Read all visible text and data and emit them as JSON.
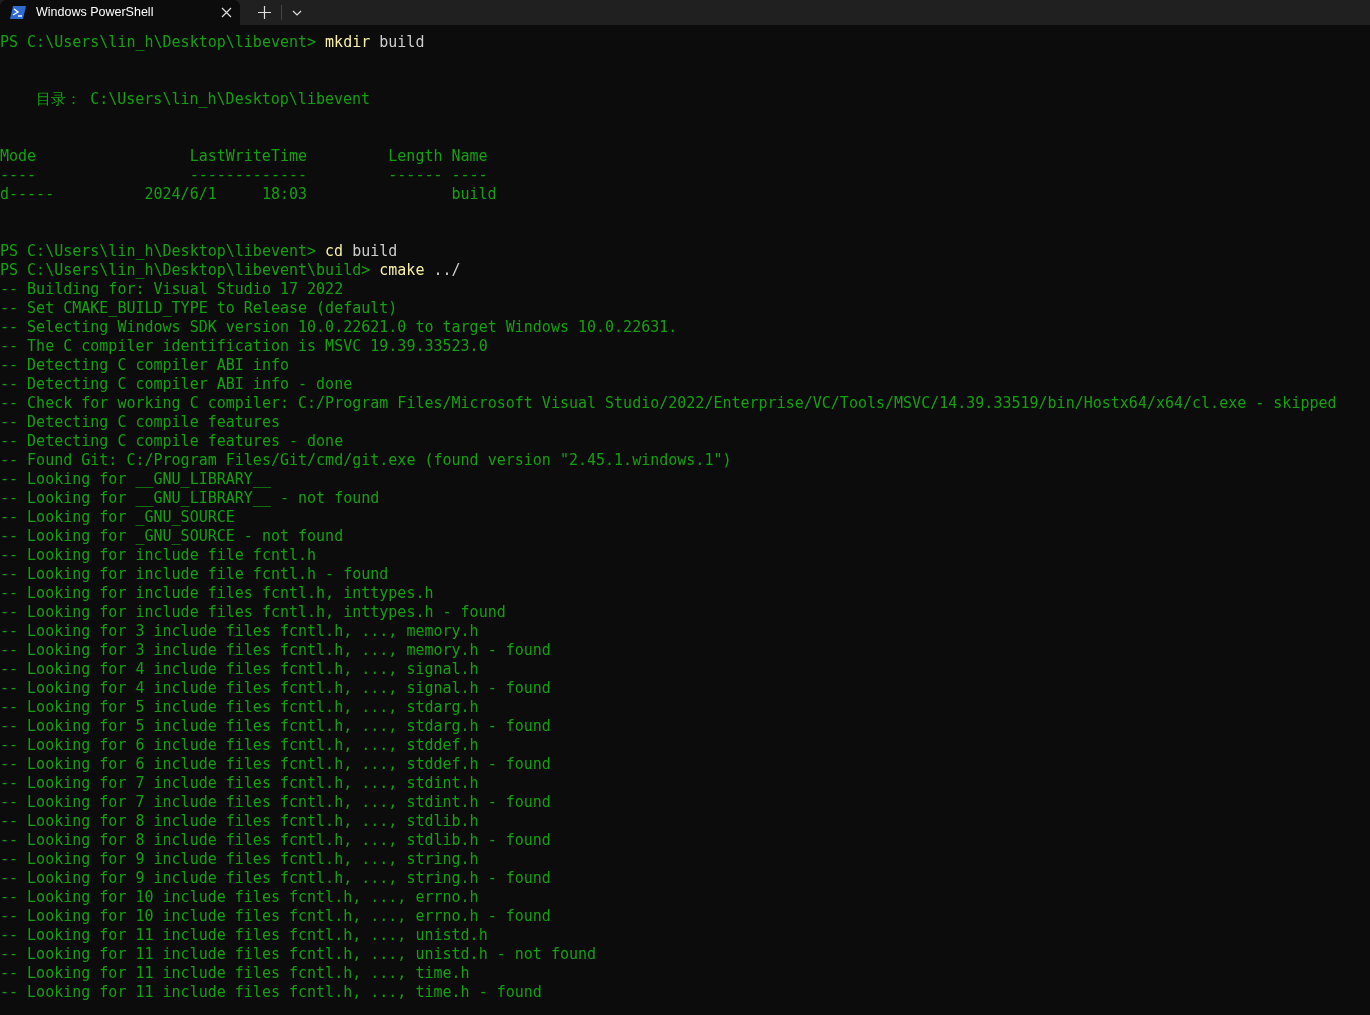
{
  "tabs": [
    {
      "title": "Windows PowerShell",
      "selected": true
    }
  ],
  "terminal": {
    "lines": [
      {
        "kind": "command",
        "prompt": "PS C:\\Users\\lin_h\\Desktop\\libevent>",
        "command": "mkdir",
        "argument": "build"
      },
      {
        "kind": "blank"
      },
      {
        "kind": "blank"
      },
      {
        "kind": "directory",
        "text": "目录： C:\\Users\\lin_h\\Desktop\\libevent"
      },
      {
        "kind": "blank"
      },
      {
        "kind": "blank"
      },
      {
        "kind": "table",
        "columns": [
          "Mode",
          "LastWriteTime",
          "Length",
          "Name"
        ],
        "rules": [
          "----",
          "-------------",
          "------",
          "----"
        ],
        "rows": [
          {
            "mode": "d-----",
            "date": "2024/6/1",
            "time": "18:03",
            "name": "build"
          }
        ]
      },
      {
        "kind": "blank"
      },
      {
        "kind": "blank"
      },
      {
        "kind": "command",
        "prompt": "PS C:\\Users\\lin_h\\Desktop\\libevent>",
        "command": "cd",
        "argument": "build"
      },
      {
        "kind": "command",
        "prompt": "PS C:\\Users\\lin_h\\Desktop\\libevent\\build>",
        "command": "cmake",
        "argument": "../"
      },
      {
        "kind": "output",
        "text": "-- Building for: Visual Studio 17 2022"
      },
      {
        "kind": "output",
        "text": "-- Set CMAKE_BUILD_TYPE to Release (default)"
      },
      {
        "kind": "output",
        "text": "-- Selecting Windows SDK version 10.0.22621.0 to target Windows 10.0.22631."
      },
      {
        "kind": "output",
        "text": "-- The C compiler identification is MSVC 19.39.33523.0"
      },
      {
        "kind": "output",
        "text": "-- Detecting C compiler ABI info"
      },
      {
        "kind": "output",
        "text": "-- Detecting C compiler ABI info - done"
      },
      {
        "kind": "output",
        "text": "-- Check for working C compiler: C:/Program Files/Microsoft Visual Studio/2022/Enterprise/VC/Tools/MSVC/14.39.33519/bin/Hostx64/x64/cl.exe - skipped"
      },
      {
        "kind": "output",
        "text": "-- Detecting C compile features"
      },
      {
        "kind": "output",
        "text": "-- Detecting C compile features - done"
      },
      {
        "kind": "output",
        "text": "-- Found Git: C:/Program Files/Git/cmd/git.exe (found version \"2.45.1.windows.1\")"
      },
      {
        "kind": "output",
        "text": "-- Looking for __GNU_LIBRARY__"
      },
      {
        "kind": "output",
        "text": "-- Looking for __GNU_LIBRARY__ - not found"
      },
      {
        "kind": "output",
        "text": "-- Looking for _GNU_SOURCE"
      },
      {
        "kind": "output",
        "text": "-- Looking for _GNU_SOURCE - not found"
      },
      {
        "kind": "output",
        "text": "-- Looking for include file fcntl.h"
      },
      {
        "kind": "output",
        "text": "-- Looking for include file fcntl.h - found"
      },
      {
        "kind": "output",
        "text": "-- Looking for include files fcntl.h, inttypes.h"
      },
      {
        "kind": "output",
        "text": "-- Looking for include files fcntl.h, inttypes.h - found"
      },
      {
        "kind": "output",
        "text": "-- Looking for 3 include files fcntl.h, ..., memory.h"
      },
      {
        "kind": "output",
        "text": "-- Looking for 3 include files fcntl.h, ..., memory.h - found"
      },
      {
        "kind": "output",
        "text": "-- Looking for 4 include files fcntl.h, ..., signal.h"
      },
      {
        "kind": "output",
        "text": "-- Looking for 4 include files fcntl.h, ..., signal.h - found"
      },
      {
        "kind": "output",
        "text": "-- Looking for 5 include files fcntl.h, ..., stdarg.h"
      },
      {
        "kind": "output",
        "text": "-- Looking for 5 include files fcntl.h, ..., stdarg.h - found"
      },
      {
        "kind": "output",
        "text": "-- Looking for 6 include files fcntl.h, ..., stddef.h"
      },
      {
        "kind": "output",
        "text": "-- Looking for 6 include files fcntl.h, ..., stddef.h - found"
      },
      {
        "kind": "output",
        "text": "-- Looking for 7 include files fcntl.h, ..., stdint.h"
      },
      {
        "kind": "output",
        "text": "-- Looking for 7 include files fcntl.h, ..., stdint.h - found"
      },
      {
        "kind": "output",
        "text": "-- Looking for 8 include files fcntl.h, ..., stdlib.h"
      },
      {
        "kind": "output",
        "text": "-- Looking for 8 include files fcntl.h, ..., stdlib.h - found"
      },
      {
        "kind": "output",
        "text": "-- Looking for 9 include files fcntl.h, ..., string.h"
      },
      {
        "kind": "output",
        "text": "-- Looking for 9 include files fcntl.h, ..., string.h - found"
      },
      {
        "kind": "output",
        "text": "-- Looking for 10 include files fcntl.h, ..., errno.h"
      },
      {
        "kind": "output",
        "text": "-- Looking for 10 include files fcntl.h, ..., errno.h - found"
      },
      {
        "kind": "output",
        "text": "-- Looking for 11 include files fcntl.h, ..., unistd.h"
      },
      {
        "kind": "output",
        "text": "-- Looking for 11 include files fcntl.h, ..., unistd.h - not found"
      },
      {
        "kind": "output",
        "text": "-- Looking for 11 include files fcntl.h, ..., time.h"
      },
      {
        "kind": "output",
        "text": "-- Looking for 11 include files fcntl.h, ..., time.h - found"
      }
    ]
  }
}
